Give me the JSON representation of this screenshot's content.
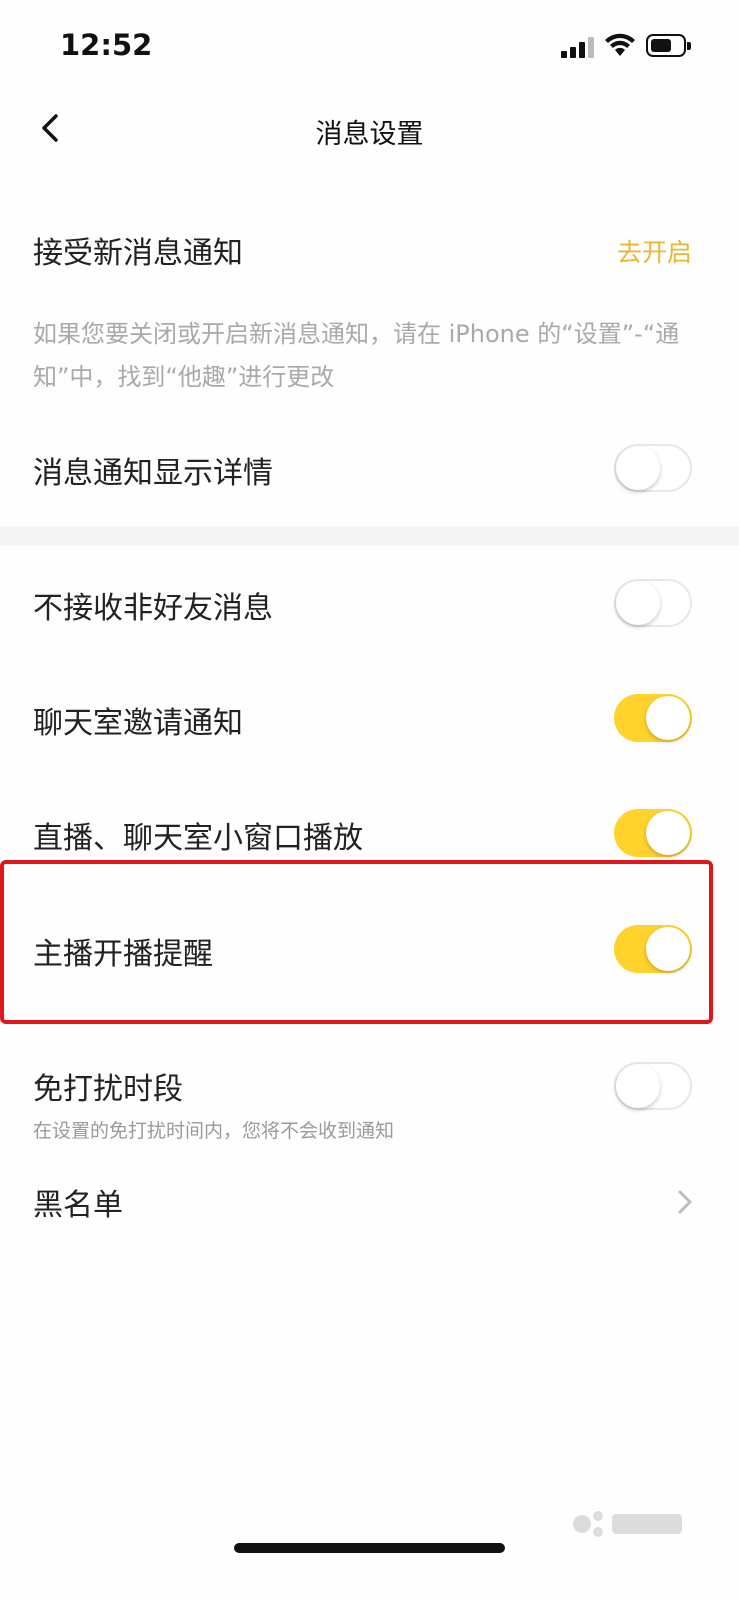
{
  "status_bar": {
    "time": "12:52"
  },
  "nav": {
    "title": "消息设置"
  },
  "notify": {
    "label": "接受新消息通知",
    "action": "去开启",
    "hint": "如果您要关闭或开启新消息通知，请在 iPhone 的“设置”-“通知”中，找到“他趣”进行更改"
  },
  "settings": [
    {
      "label": "消息通知显示详情",
      "on": false
    },
    {
      "label": "不接收非好友消息",
      "on": false
    },
    {
      "label": "聊天室邀请通知",
      "on": true
    },
    {
      "label": "直播、聊天室小窗口播放",
      "on": true
    },
    {
      "label": "主播开播提醒",
      "on": true
    },
    {
      "label": "免打扰时段",
      "on": false
    }
  ],
  "dnd": {
    "subtitle": "在设置的免打扰时间内，您将不会收到通知"
  },
  "blacklist": {
    "label": "黑名单"
  },
  "colors": {
    "accent": "#ffd22c",
    "link": "#e9b734",
    "highlight": "#e0161f"
  },
  "icons": [
    "back-arrow-icon",
    "signal-icon",
    "wifi-icon",
    "battery-icon",
    "chevron-right-icon"
  ]
}
